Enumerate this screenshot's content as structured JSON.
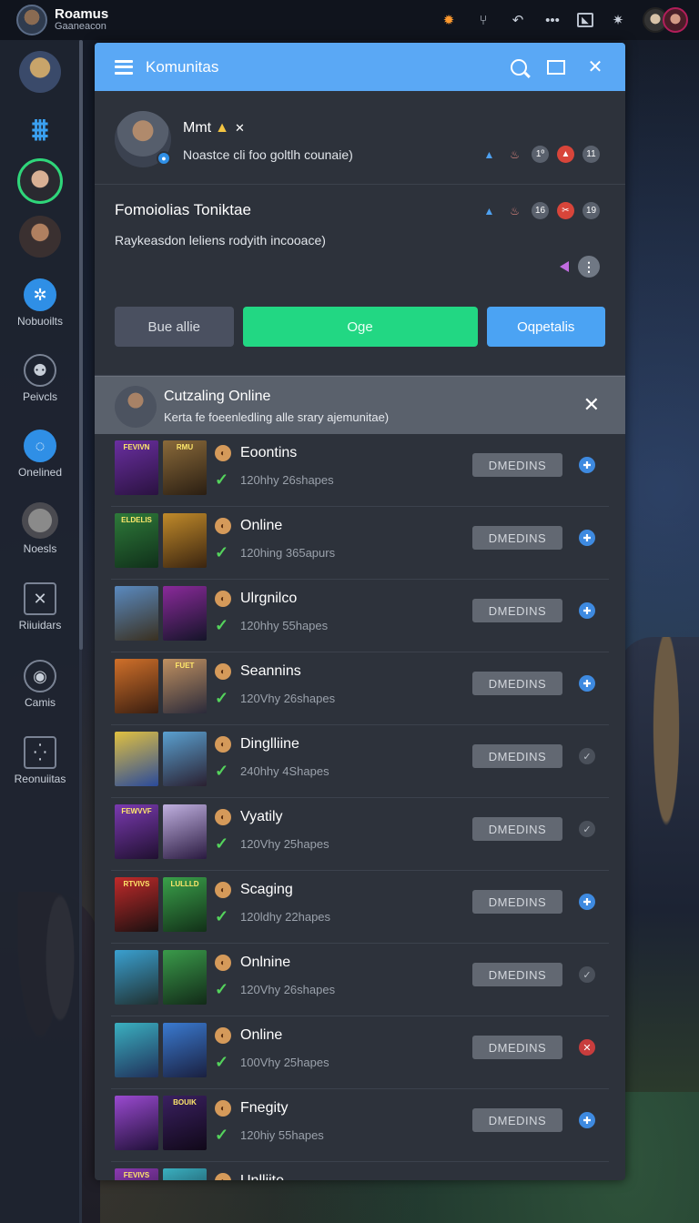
{
  "user": {
    "name": "Roamus",
    "subtitle": "Gaaneacon"
  },
  "top_icons": [
    "flame-icon",
    "fork-icon",
    "back-icon",
    "more-icon",
    "box-icon",
    "gear-icon"
  ],
  "rail": {
    "items": [
      {
        "label": "Nobuoilts",
        "icon": "star-icon"
      },
      {
        "label": "Peivcls",
        "icon": "figure-icon"
      },
      {
        "label": "Onelined",
        "icon": "drop-icon"
      },
      {
        "label": "Noesls",
        "icon": "globe-icon"
      },
      {
        "label": "Riiuidars",
        "icon": "x-box-icon"
      },
      {
        "label": "Camis",
        "icon": "target-icon"
      },
      {
        "label": "Reonuiitas",
        "icon": "grid-icon"
      }
    ]
  },
  "panel": {
    "title": "Komunitas",
    "notice1": {
      "name": "Mmt",
      "text": "Noastce cli foo goltlh counaie)",
      "stats": [
        "1º",
        "11"
      ]
    },
    "notice2": {
      "title": "Fomoiolias Toniktae",
      "text": "Raykeasdon leliens rodyith incooace)",
      "stats": [
        "16",
        "19"
      ]
    },
    "buttons": {
      "left": "Bue allie",
      "middle": "Oge",
      "right": "Oqpetalis"
    },
    "section": {
      "title": "Cutzaling Online",
      "subtitle": "Kerta fe foeenledling alle srary ajemunitae)"
    },
    "rows": [
      {
        "title": "Eoontins",
        "sub": "120hhy 26shapes",
        "btn": "DMEDINS",
        "action": "plus",
        "c1": [
          "#6a2fa0",
          "#2a1240"
        ],
        "c2": [
          "#8a6a3a",
          "#2a1e12"
        ],
        "l1": "FEVIVN",
        "l2": "RMU"
      },
      {
        "title": "Online",
        "sub": "120hing 365apurs",
        "btn": "DMEDINS",
        "action": "plus",
        "c1": [
          "#2e7a3a",
          "#10301a"
        ],
        "c2": [
          "#c08a2a",
          "#3a2410"
        ],
        "l1": "ELDELIS",
        "l2": ""
      },
      {
        "title": "Ulrgnilco",
        "sub": "120hhy 55hapes",
        "btn": "DMEDINS",
        "action": "plus",
        "c1": [
          "#5a8ac0",
          "#3a3020"
        ],
        "c2": [
          "#8a2a9a",
          "#141428"
        ],
        "l1": "",
        "l2": ""
      },
      {
        "title": "Seannins",
        "sub": "120Vhy 26shapes",
        "btn": "DMEDINS",
        "action": "plus",
        "c1": [
          "#d0702a",
          "#3a1e10"
        ],
        "c2": [
          "#c09060",
          "#2a2a3a"
        ],
        "l1": "",
        "l2": "FUET"
      },
      {
        "title": "Dinglliine",
        "sub": "240hhy 4Shapes",
        "btn": "DMEDINS",
        "action": "check",
        "c1": [
          "#e0c040",
          "#2a4a9a"
        ],
        "c2": [
          "#5aa0d0",
          "#2a2030"
        ],
        "l1": "",
        "l2": ""
      },
      {
        "title": "Vyatily",
        "sub": "120Vhy 25hapes",
        "btn": "DMEDINS",
        "action": "check",
        "c1": [
          "#7a3ab0",
          "#201030"
        ],
        "c2": [
          "#c0b0e0",
          "#2a1a40"
        ],
        "l1": "FEWVVF",
        "l2": ""
      },
      {
        "title": "Scaging",
        "sub": "120ldhy 22hapes",
        "btn": "DMEDINS",
        "action": "plus",
        "c1": [
          "#c02a2a",
          "#1a1010"
        ],
        "c2": [
          "#3aa04a",
          "#123018"
        ],
        "l1": "RTVIVS",
        "l2": "LULLLD"
      },
      {
        "title": "Onlnine",
        "sub": "120Vhy 26shapes",
        "btn": "DMEDINS",
        "action": "check",
        "c1": [
          "#3aa0d0",
          "#203030"
        ],
        "c2": [
          "#3a9a4a",
          "#122a18"
        ],
        "l1": "",
        "l2": ""
      },
      {
        "title": "Online",
        "sub": "100Vhy 25hapes",
        "btn": "DMEDINS",
        "action": "x",
        "c1": [
          "#3ab0c0",
          "#20305a"
        ],
        "c2": [
          "#3a7ad0",
          "#1a2040"
        ],
        "l1": "",
        "l2": ""
      },
      {
        "title": "Fnegity",
        "sub": "120hiy 55hapes",
        "btn": "DMEDINS",
        "action": "plus",
        "c1": [
          "#9a4ad0",
          "#201038"
        ],
        "c2": [
          "#3a2060",
          "#100818"
        ],
        "l1": "",
        "l2": "BOUIK"
      },
      {
        "title": "Unlliite",
        "sub": "",
        "btn": "",
        "action": "",
        "c1": [
          "#8a3ab0",
          "#201030"
        ],
        "c2": [
          "#3ab0c0",
          "#102030"
        ],
        "l1": "FEVIVS",
        "l2": ""
      }
    ]
  }
}
